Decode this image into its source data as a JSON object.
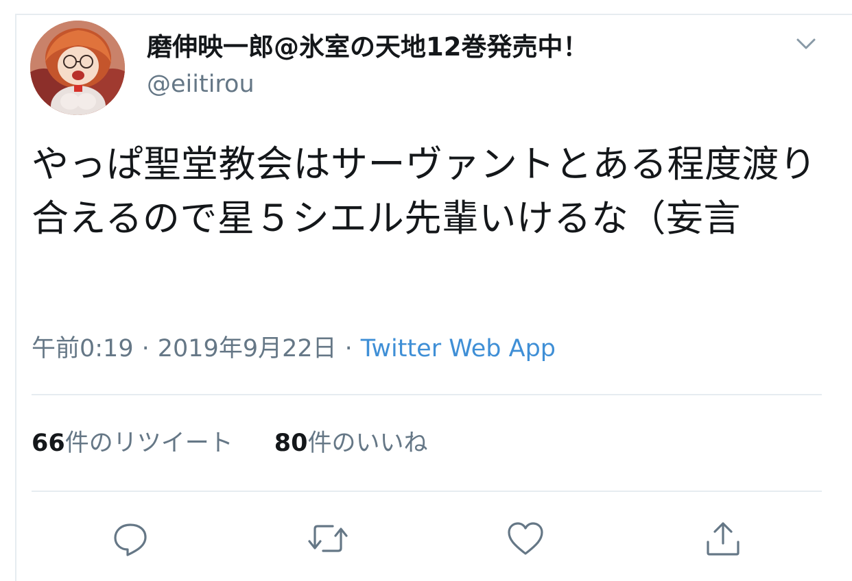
{
  "user": {
    "display_name": "磨伸映一郎@氷室の天地12巻発売中！",
    "handle": "@eiitirou"
  },
  "tweet": {
    "text": "やっぱ聖堂教会はサーヴァントとある程度渡り合えるので星５シエル先輩いけるな（妄言",
    "time": "午前0:19",
    "date": "2019年9月22日",
    "separator": "·",
    "source": "Twitter Web App"
  },
  "stats": {
    "retweet_count": "66",
    "retweet_label": "件のリツイート",
    "like_count": "80",
    "like_label": "件のいいね"
  },
  "icons": {
    "caret": "chevron-down-icon",
    "reply": "reply-icon",
    "retweet": "retweet-icon",
    "like": "heart-icon",
    "share": "share-icon"
  },
  "colors": {
    "text": "#14171a",
    "secondary": "#657786",
    "link": "#3f8fd6",
    "divider": "#e6ecf0"
  }
}
